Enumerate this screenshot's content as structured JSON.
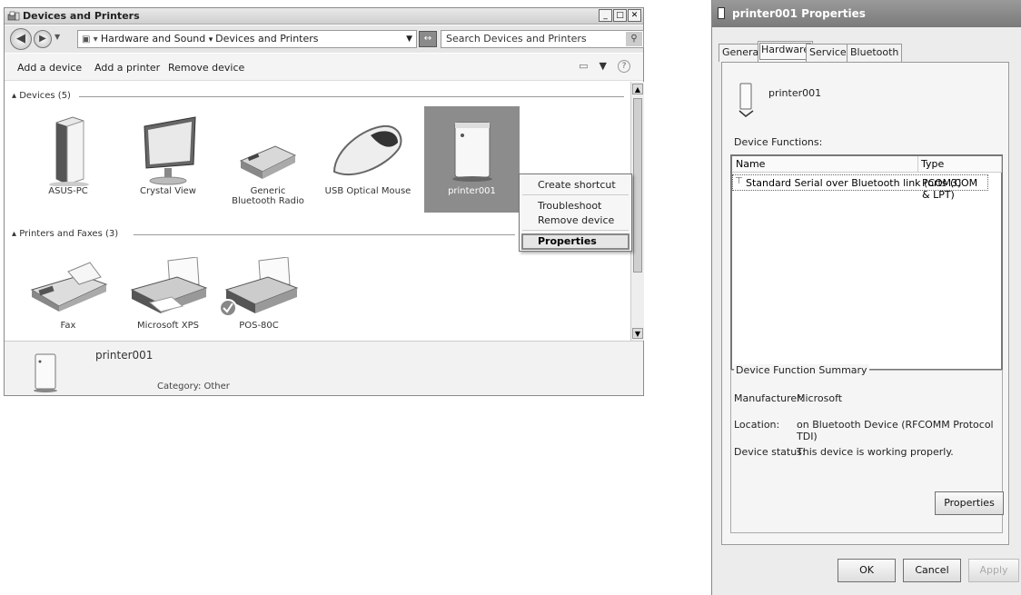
{
  "explorer": {
    "title": "Devices and Printers",
    "breadcrumb": [
      "Hardware and Sound",
      "Devices and Printers"
    ],
    "search_placeholder": "Search Devices and Printers",
    "commands": [
      "Add a device",
      "Add a printer",
      "Remove device"
    ],
    "groups": {
      "devices": "Devices (5)",
      "printers": "Printers and Faxes (3)"
    },
    "devices": [
      "ASUS-PC",
      "Crystal View",
      "Generic Bluetooth Radio",
      "USB Optical Mouse",
      "printer001"
    ],
    "printers": [
      "Fax",
      "Microsoft XPS",
      "POS-80C"
    ],
    "context_menu": [
      "Create shortcut",
      "Troubleshoot",
      "Remove device",
      "Properties"
    ],
    "details": {
      "name": "printer001",
      "category": "Category: Other"
    }
  },
  "dialog": {
    "title": "printer001 Properties",
    "tabs": [
      "General",
      "Hardware",
      "Services",
      "Bluetooth"
    ],
    "active_tab": "Hardware",
    "device_name": "printer001",
    "functions_label": "Device Functions:",
    "columns": [
      "Name",
      "Type"
    ],
    "rows": [
      [
        "Standard Serial over Bluetooth link (COM3)",
        "Ports (COM & LPT)"
      ]
    ],
    "summary_title": "Device Function Summary",
    "manufacturer_label": "Manufacturer:",
    "manufacturer": "Microsoft",
    "location_label": "Location:",
    "location": "on Bluetooth Device (RFCOMM Protocol TDI)",
    "status_label": "Device status:",
    "status": "This device is working properly.",
    "properties_button": "Properties",
    "ok": "OK",
    "cancel": "Cancel",
    "apply": "Apply"
  }
}
